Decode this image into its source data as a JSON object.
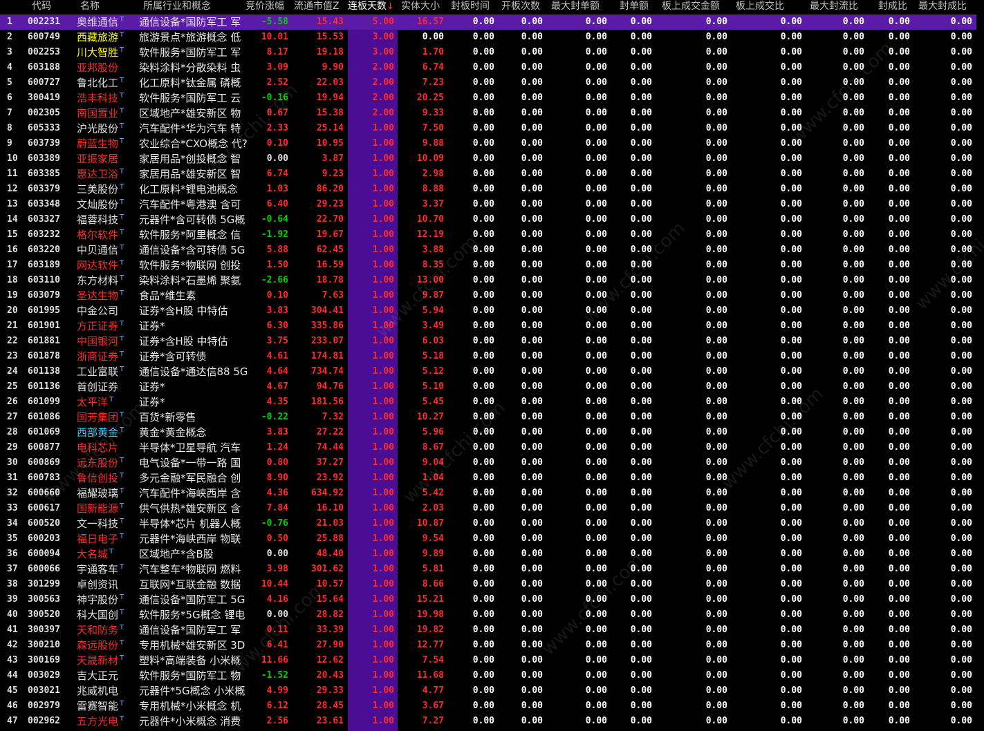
{
  "colors": {
    "up": "#ff2a2a",
    "down": "#00d000",
    "flat": "#e0e0e0",
    "neutral_name": "#e0e0e0",
    "name_red": "#ff2a2a",
    "name_yellow": "#ffff00",
    "name_cyan": "#33ccff",
    "name_orange": "#ff8000",
    "cap": "#ffdd33",
    "zero": "#ffffff",
    "highlight_bg": "#4b0d93",
    "selected_bg": "#5b1aa8"
  },
  "header": {
    "code": "代码",
    "name": "名称",
    "industry": "所属行业和概念",
    "auction_change": "竞价涨幅",
    "float_cap": "流通市值Z",
    "limit_days": "连板天数",
    "sort_arrow": "↓",
    "body_size": "实体大小",
    "seal_time": "封板时间",
    "open_count": "开板次数",
    "max_seal_amt": "最大封单额",
    "seal_amt": "封单额",
    "limit_turnover": "板上成交金额",
    "limit_turnover_ratio": "板上成交比",
    "max_seal_float_ratio": "最大封流比",
    "seal_ratio": "封成比",
    "max_seal_ratio": "最大封成比"
  },
  "watermark": "www.cfchi.com",
  "rows": [
    {
      "idx": "1",
      "code": "002231",
      "name": "奥维通信",
      "name_color": "neutral",
      "t": true,
      "ind": "通信设备*国防军工 军",
      "chg": "-5.58",
      "dir": "down",
      "cap": "15.43",
      "days": "5.00",
      "body": "16.57",
      "bodycolor": "up"
    },
    {
      "idx": "2",
      "code": "600749",
      "name": "西藏旅游",
      "name_color": "yellow",
      "t": true,
      "ind": "旅游景点*旅游概念 低",
      "chg": "10.01",
      "dir": "up",
      "cap": "15.53",
      "days": "3.00",
      "body": "0.00",
      "bodycolor": "zero"
    },
    {
      "idx": "3",
      "code": "002253",
      "name": "川大智胜",
      "name_color": "yellow",
      "t": true,
      "ind": "软件服务*国防军工 军",
      "chg": "8.17",
      "dir": "up",
      "cap": "19.18",
      "days": "3.00",
      "body": "1.70",
      "bodycolor": "up"
    },
    {
      "idx": "4",
      "code": "603188",
      "name": "亚邦股份",
      "name_color": "red",
      "t": false,
      "ind": "染料涂料*分散染料 虫",
      "chg": "3.09",
      "dir": "up",
      "cap": "9.90",
      "days": "2.00",
      "body": "6.74",
      "bodycolor": "up"
    },
    {
      "idx": "5",
      "code": "600727",
      "name": "鲁北化工",
      "name_color": "neutral",
      "t": true,
      "ind": "化工原料*钛金属 磷概",
      "chg": "2.52",
      "dir": "up",
      "cap": "22.03",
      "days": "2.00",
      "body": "7.23",
      "bodycolor": "up"
    },
    {
      "idx": "6",
      "code": "300419",
      "name": "浩丰科技",
      "name_color": "red",
      "t": true,
      "ind": "软件服务*国防军工 云",
      "chg": "-0.16",
      "dir": "down",
      "cap": "19.94",
      "days": "2.00",
      "body": "20.25",
      "bodycolor": "up"
    },
    {
      "idx": "7",
      "code": "002305",
      "name": "南国置业",
      "name_color": "red",
      "t": true,
      "ind": "区域地产*雄安新区 物",
      "chg": "0.67",
      "dir": "up",
      "cap": "15.38",
      "days": "2.00",
      "body": "9.33",
      "bodycolor": "up"
    },
    {
      "idx": "8",
      "code": "605333",
      "name": "沪光股份",
      "name_color": "neutral",
      "t": true,
      "ind": "汽车配件*华为汽车 特",
      "chg": "2.33",
      "dir": "up",
      "cap": "25.14",
      "days": "1.00",
      "body": "7.50",
      "bodycolor": "up"
    },
    {
      "idx": "9",
      "code": "603739",
      "name": "蔚蓝生物",
      "name_color": "red",
      "t": true,
      "ind": "农业综合*CXO概念 代?",
      "chg": "0.10",
      "dir": "up",
      "cap": "10.95",
      "days": "1.00",
      "body": "9.88",
      "bodycolor": "up"
    },
    {
      "idx": "10",
      "code": "603389",
      "name": "亚振家居",
      "name_color": "red",
      "t": false,
      "ind": "家居用品*创投概念 智",
      "chg": "0.00",
      "dir": "flat",
      "cap": "3.87",
      "days": "1.00",
      "body": "10.09",
      "bodycolor": "up"
    },
    {
      "idx": "11",
      "code": "603385",
      "name": "惠达卫浴",
      "name_color": "red",
      "t": true,
      "ind": "家居用品*雄安新区 智",
      "chg": "6.74",
      "dir": "up",
      "cap": "9.23",
      "days": "1.00",
      "body": "2.98",
      "bodycolor": "up"
    },
    {
      "idx": "12",
      "code": "603379",
      "name": "三美股份",
      "name_color": "neutral",
      "t": true,
      "ind": "化工原料*锂电池概念",
      "chg": "1.03",
      "dir": "up",
      "cap": "86.20",
      "days": "1.00",
      "body": "8.88",
      "bodycolor": "up"
    },
    {
      "idx": "13",
      "code": "603348",
      "name": "文灿股份",
      "name_color": "neutral",
      "t": true,
      "ind": "汽车配件*粤港澳 含可",
      "chg": "6.40",
      "dir": "up",
      "cap": "29.23",
      "days": "1.00",
      "body": "3.37",
      "bodycolor": "up"
    },
    {
      "idx": "14",
      "code": "603327",
      "name": "福蓉科技",
      "name_color": "neutral",
      "t": true,
      "ind": "元器件*含可转债 5G概",
      "chg": "-0.64",
      "dir": "down",
      "cap": "22.70",
      "days": "1.00",
      "body": "10.70",
      "bodycolor": "up"
    },
    {
      "idx": "15",
      "code": "603232",
      "name": "格尔软件",
      "name_color": "red",
      "t": true,
      "ind": "软件服务*阿里概念 信",
      "chg": "-1.92",
      "dir": "down",
      "cap": "19.67",
      "days": "1.00",
      "body": "12.19",
      "bodycolor": "up"
    },
    {
      "idx": "16",
      "code": "603220",
      "name": "中贝通信",
      "name_color": "neutral",
      "t": true,
      "ind": "通信设备*含可转债 5G",
      "chg": "5.88",
      "dir": "up",
      "cap": "62.45",
      "days": "1.00",
      "body": "3.88",
      "bodycolor": "up"
    },
    {
      "idx": "17",
      "code": "603189",
      "name": "网达软件",
      "name_color": "red",
      "t": true,
      "ind": "软件服务*物联网 创投",
      "chg": "1.50",
      "dir": "up",
      "cap": "16.59",
      "days": "1.00",
      "body": "8.35",
      "bodycolor": "up"
    },
    {
      "idx": "18",
      "code": "603110",
      "name": "东方材料",
      "name_color": "neutral",
      "t": true,
      "ind": "染料涂料*石墨烯 聚氨",
      "chg": "-2.66",
      "dir": "down",
      "cap": "18.78",
      "days": "1.00",
      "body": "13.00",
      "bodycolor": "up"
    },
    {
      "idx": "19",
      "code": "603079",
      "name": "圣达生物",
      "name_color": "red",
      "t": true,
      "ind": "食品*维生素",
      "chg": "0.10",
      "dir": "up",
      "cap": "7.63",
      "days": "1.00",
      "body": "9.87",
      "bodycolor": "up"
    },
    {
      "idx": "20",
      "code": "601995",
      "name": "中金公司",
      "name_color": "neutral",
      "t": false,
      "ind": "证券*含H股 中特估",
      "chg": "3.83",
      "dir": "up",
      "cap": "304.41",
      "days": "1.00",
      "body": "5.94",
      "bodycolor": "up"
    },
    {
      "idx": "21",
      "code": "601901",
      "name": "方正证券",
      "name_color": "red",
      "t": true,
      "ind": "证券*",
      "chg": "6.30",
      "dir": "up",
      "cap": "335.86",
      "days": "1.00",
      "body": "3.49",
      "bodycolor": "up"
    },
    {
      "idx": "22",
      "code": "601881",
      "name": "中国银河",
      "name_color": "red",
      "t": true,
      "ind": "证券*含H股 中特估",
      "chg": "3.75",
      "dir": "up",
      "cap": "233.07",
      "days": "1.00",
      "body": "6.03",
      "bodycolor": "up"
    },
    {
      "idx": "23",
      "code": "601878",
      "name": "浙商证券",
      "name_color": "red",
      "t": true,
      "ind": "证券*含可转债",
      "chg": "4.61",
      "dir": "up",
      "cap": "174.81",
      "days": "1.00",
      "body": "5.18",
      "bodycolor": "up"
    },
    {
      "idx": "24",
      "code": "601138",
      "name": "工业富联",
      "name_color": "neutral",
      "t": true,
      "ind": "通信设备*通达信88 5G",
      "chg": "4.64",
      "dir": "up",
      "cap": "734.74",
      "days": "1.00",
      "body": "5.12",
      "bodycolor": "up"
    },
    {
      "idx": "25",
      "code": "601136",
      "name": "首创证券",
      "name_color": "neutral",
      "t": false,
      "ind": "证券*",
      "chg": "4.67",
      "dir": "up",
      "cap": "94.76",
      "days": "1.00",
      "body": "5.10",
      "bodycolor": "up"
    },
    {
      "idx": "26",
      "code": "601099",
      "name": "太平洋",
      "name_color": "red",
      "t": true,
      "ind": "证券*",
      "chg": "4.35",
      "dir": "up",
      "cap": "181.56",
      "days": "1.00",
      "body": "5.45",
      "bodycolor": "up"
    },
    {
      "idx": "27",
      "code": "601086",
      "name": "国芳集团",
      "name_color": "red",
      "t": true,
      "ind": "百货*新零售",
      "chg": "-0.22",
      "dir": "down",
      "cap": "7.32",
      "days": "1.00",
      "body": "10.27",
      "bodycolor": "up"
    },
    {
      "idx": "28",
      "code": "601069",
      "name": "西部黄金",
      "name_color": "cyan",
      "t": true,
      "ind": "黄金*黄金概念",
      "chg": "3.83",
      "dir": "up",
      "cap": "27.22",
      "days": "1.00",
      "body": "5.96",
      "bodycolor": "up"
    },
    {
      "idx": "29",
      "code": "600877",
      "name": "电科芯片",
      "name_color": "red",
      "t": false,
      "ind": "半导体*卫星导航 汽车",
      "chg": "1.24",
      "dir": "up",
      "cap": "74.44",
      "days": "1.00",
      "body": "8.67",
      "bodycolor": "up"
    },
    {
      "idx": "30",
      "code": "600869",
      "name": "远东股份",
      "name_color": "red",
      "t": true,
      "ind": "电气设备*一带一路 国",
      "chg": "0.80",
      "dir": "up",
      "cap": "37.27",
      "days": "1.00",
      "body": "9.04",
      "bodycolor": "up"
    },
    {
      "idx": "31",
      "code": "600783",
      "name": "鲁信创投",
      "name_color": "red",
      "t": true,
      "ind": "多元金融*军民融合 创",
      "chg": "8.90",
      "dir": "up",
      "cap": "23.92",
      "days": "1.00",
      "body": "1.04",
      "bodycolor": "up"
    },
    {
      "idx": "32",
      "code": "600660",
      "name": "福耀玻璃",
      "name_color": "neutral",
      "t": true,
      "ind": "汽车配件*海峡西岸 含",
      "chg": "4.36",
      "dir": "up",
      "cap": "634.92",
      "days": "1.00",
      "body": "5.42",
      "bodycolor": "up"
    },
    {
      "idx": "33",
      "code": "600617",
      "name": "国新能源",
      "name_color": "red",
      "t": true,
      "ind": "供气供热*雄安新区 含",
      "chg": "7.84",
      "dir": "up",
      "cap": "16.10",
      "days": "1.00",
      "body": "2.03",
      "bodycolor": "up"
    },
    {
      "idx": "34",
      "code": "600520",
      "name": "文一科技",
      "name_color": "neutral",
      "t": true,
      "ind": "半导体*芯片 机器人概",
      "chg": "-0.76",
      "dir": "down",
      "cap": "21.03",
      "days": "1.00",
      "body": "10.87",
      "bodycolor": "up"
    },
    {
      "idx": "35",
      "code": "600203",
      "name": "福日电子",
      "name_color": "red",
      "t": true,
      "ind": "元器件*海峡西岸 物联",
      "chg": "0.50",
      "dir": "up",
      "cap": "25.88",
      "days": "1.00",
      "body": "9.54",
      "bodycolor": "up"
    },
    {
      "idx": "36",
      "code": "600094",
      "name": "大名城",
      "name_color": "red",
      "t": true,
      "ind": "区域地产*含B股",
      "chg": "0.00",
      "dir": "flat",
      "cap": "48.40",
      "days": "1.00",
      "body": "9.89",
      "bodycolor": "up"
    },
    {
      "idx": "37",
      "code": "600066",
      "name": "宇通客车",
      "name_color": "neutral",
      "t": true,
      "ind": "汽车整车*物联网 燃料",
      "chg": "3.98",
      "dir": "up",
      "cap": "301.62",
      "days": "1.00",
      "body": "5.81",
      "bodycolor": "up"
    },
    {
      "idx": "38",
      "code": "301299",
      "name": "卓创资讯",
      "name_color": "neutral",
      "t": false,
      "ind": "互联网*互联金融 数据",
      "chg": "10.44",
      "dir": "up",
      "cap": "10.57",
      "days": "1.00",
      "body": "8.66",
      "bodycolor": "up"
    },
    {
      "idx": "39",
      "code": "300563",
      "name": "神宇股份",
      "name_color": "neutral",
      "t": true,
      "ind": "通信设备*国防军工 5G",
      "chg": "4.16",
      "dir": "up",
      "cap": "15.64",
      "days": "1.00",
      "body": "15.21",
      "bodycolor": "up"
    },
    {
      "idx": "40",
      "code": "300520",
      "name": "科大国创",
      "name_color": "neutral",
      "t": true,
      "ind": "软件服务*5G概念 锂电",
      "chg": "0.00",
      "dir": "flat",
      "cap": "28.82",
      "days": "1.00",
      "body": "19.98",
      "bodycolor": "up"
    },
    {
      "idx": "41",
      "code": "300397",
      "name": "天和防务",
      "name_color": "red",
      "t": true,
      "ind": "通信设备*国防军工 军",
      "chg": "0.11",
      "dir": "up",
      "cap": "33.39",
      "days": "1.00",
      "body": "19.82",
      "bodycolor": "up"
    },
    {
      "idx": "42",
      "code": "300210",
      "name": "森远股份",
      "name_color": "red",
      "t": true,
      "ind": "专用机械*雄安新区 3D",
      "chg": "6.41",
      "dir": "up",
      "cap": "27.90",
      "days": "1.00",
      "body": "12.77",
      "bodycolor": "up"
    },
    {
      "idx": "43",
      "code": "300169",
      "name": "天晟新材",
      "name_color": "red",
      "t": true,
      "ind": "塑料*高端装备 小米概",
      "chg": "11.66",
      "dir": "up",
      "cap": "12.62",
      "days": "1.00",
      "body": "7.54",
      "bodycolor": "up"
    },
    {
      "idx": "44",
      "code": "003029",
      "name": "吉大正元",
      "name_color": "neutral",
      "t": false,
      "ind": "软件服务*国防军工 物",
      "chg": "-1.52",
      "dir": "down",
      "cap": "20.43",
      "days": "1.00",
      "body": "11.68",
      "bodycolor": "up"
    },
    {
      "idx": "45",
      "code": "003021",
      "name": "兆威机电",
      "name_color": "neutral",
      "t": false,
      "ind": "元器件*5G概念 小米概",
      "chg": "4.99",
      "dir": "up",
      "cap": "29.33",
      "days": "1.00",
      "body": "4.77",
      "bodycolor": "up"
    },
    {
      "idx": "46",
      "code": "002979",
      "name": "雷赛智能",
      "name_color": "neutral",
      "t": true,
      "ind": "专用机械*小米概念 机",
      "chg": "6.12",
      "dir": "up",
      "cap": "28.45",
      "days": "1.00",
      "body": "3.67",
      "bodycolor": "up"
    },
    {
      "idx": "47",
      "code": "002962",
      "name": "五方光电",
      "name_color": "red",
      "t": true,
      "ind": "元器件*小米概念 消费",
      "chg": "2.56",
      "dir": "up",
      "cap": "23.61",
      "days": "1.00",
      "body": "7.27",
      "bodycolor": "up"
    }
  ],
  "zero_value": "0.00",
  "t_mark": "T"
}
